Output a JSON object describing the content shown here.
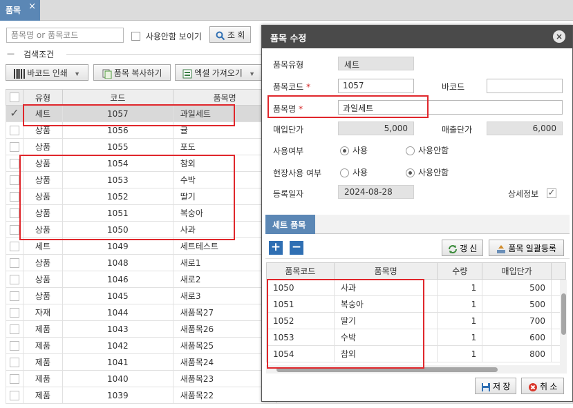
{
  "tab": {
    "label": "품목",
    "close": "×"
  },
  "search": {
    "placeholder": "품목명 or 품목코드",
    "unused_label": "사용안함 보이기",
    "search_button": "조 회"
  },
  "filter": {
    "toggle": "—",
    "label": "검색조건"
  },
  "toolbar": {
    "barcode_print": "바코드 인쇄",
    "copy_item": "품목 복사하기",
    "excel_import": "엑셀 가져오기",
    "dropdown": "▼"
  },
  "grid": {
    "columns": [
      "유형",
      "코드",
      "품목명"
    ],
    "rows": [
      {
        "type": "세트",
        "code": "1057",
        "name": "과일세트",
        "selected": true
      },
      {
        "type": "상품",
        "code": "1056",
        "name": "귤"
      },
      {
        "type": "상품",
        "code": "1055",
        "name": "포도"
      },
      {
        "type": "상품",
        "code": "1054",
        "name": "참외"
      },
      {
        "type": "상품",
        "code": "1053",
        "name": "수박"
      },
      {
        "type": "상품",
        "code": "1052",
        "name": "딸기"
      },
      {
        "type": "상품",
        "code": "1051",
        "name": "복숭아"
      },
      {
        "type": "상품",
        "code": "1050",
        "name": "사과"
      },
      {
        "type": "세트",
        "code": "1049",
        "name": "세트테스트"
      },
      {
        "type": "상품",
        "code": "1048",
        "name": "새로1"
      },
      {
        "type": "상품",
        "code": "1046",
        "name": "새로2"
      },
      {
        "type": "상품",
        "code": "1045",
        "name": "새로3"
      },
      {
        "type": "자재",
        "code": "1044",
        "name": "새품목27"
      },
      {
        "type": "제품",
        "code": "1043",
        "name": "새품목26"
      },
      {
        "type": "제품",
        "code": "1042",
        "name": "새품목25"
      },
      {
        "type": "제품",
        "code": "1041",
        "name": "새품목24"
      },
      {
        "type": "제품",
        "code": "1040",
        "name": "새품목23"
      },
      {
        "type": "제품",
        "code": "1039",
        "name": "새품목22"
      }
    ]
  },
  "modal": {
    "title": "품목 수정",
    "close": "×",
    "item_type_label": "품목유형",
    "item_type_value": "세트",
    "item_code_label": "품목코드",
    "item_code_value": "1057",
    "required": "*",
    "barcode_label": "바코드",
    "barcode_value": "",
    "item_name_label": "품목명",
    "item_name_value": "과일세트",
    "buy_price_label": "매입단가",
    "buy_price_value": "5,000",
    "sell_price_label": "매출단가",
    "sell_price_value": "6,000",
    "use_label": "사용여부",
    "use_yes": "사용",
    "use_no": "사용안함",
    "field_use_label": "현장사용 여부",
    "field_yes": "사용",
    "field_no": "사용안함",
    "reg_date_label": "등록일자",
    "reg_date_value": "2024-08-28",
    "detail_label": "상세정보",
    "detail_check": "✓",
    "set_tab": "세트 품목",
    "add": "+",
    "remove": "−",
    "refresh_button": "갱 신",
    "bulk_register_button": "품목 일괄등록",
    "set_columns": [
      "품목코드",
      "품목명",
      "수량",
      "매입단가"
    ],
    "set_rows": [
      {
        "code": "1050",
        "name": "사과",
        "qty": "1",
        "price": "500"
      },
      {
        "code": "1051",
        "name": "복숭아",
        "qty": "1",
        "price": "500"
      },
      {
        "code": "1052",
        "name": "딸기",
        "qty": "1",
        "price": "700"
      },
      {
        "code": "1053",
        "name": "수박",
        "qty": "1",
        "price": "600"
      },
      {
        "code": "1054",
        "name": "참외",
        "qty": "1",
        "price": "800"
      }
    ],
    "save_button": "저 장",
    "cancel_button": "취 소"
  },
  "colors": {
    "tab_blue": "#5b87b5",
    "header_dark": "#4a4a4a",
    "highlight_red": "#e0262b",
    "action_blue": "#2f6fb3"
  }
}
